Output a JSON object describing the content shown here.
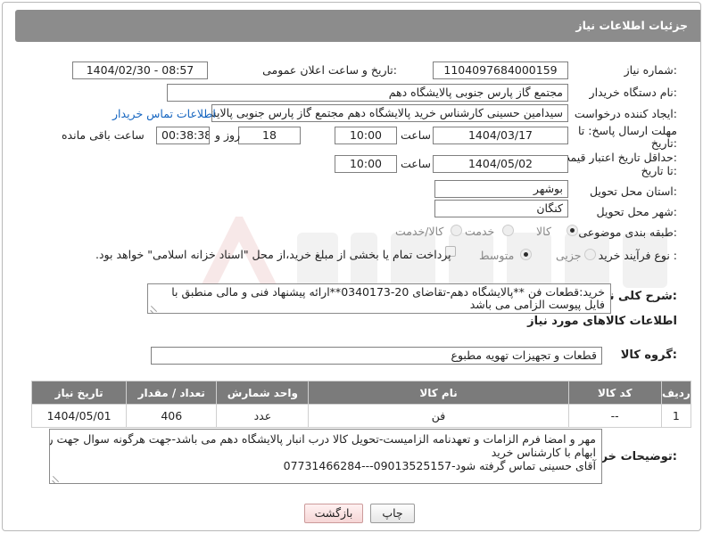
{
  "header": {
    "title": "جزئیات اطلاعات نیاز"
  },
  "form": {
    "need_number_label": "شماره نیاز:",
    "need_number": "1104097684000159",
    "announce_label": "تاریخ و ساعت اعلان عمومی:",
    "announce_value": "1404/02/30 - 08:57",
    "buyer_org_label": "نام دستگاه خریدار:",
    "buyer_org": "مجتمع گاز پارس جنوبی  پالایشگاه دهم",
    "creator_label": "ایجاد کننده درخواست:",
    "creator": "سیدامین حسینی کارشناس خرید پالایشگاه دهم  مجتمع گاز پارس جنوبی  پالایشگاه دهم",
    "contact_link": "اطلاعات تماس خریدار",
    "deadline_label_1": "مهلت ارسال پاسخ: تا",
    "deadline_label_2": "تاریخ:",
    "deadline_date": "1404/03/17",
    "time_label": "ساعت",
    "deadline_time": "10:00",
    "days_value": "18",
    "days_label": "روز و",
    "remaining_time": "00:38:38",
    "remaining_label": "ساعت باقی مانده",
    "validity_label_1": "حداقل تاریخ اعتبار قیمت:",
    "validity_label_2": "تا تاریخ:",
    "validity_date": "1404/05/02",
    "validity_time": "10:00",
    "province_label": "استان محل تحویل:",
    "province": "بوشهر",
    "city_label": "شهر محل تحویل:",
    "city": "کنگان",
    "category_label": "طبقه بندی موضوعی:",
    "category_options": [
      "کالا",
      "خدمت",
      "کالا/خدمت"
    ],
    "category_selected": "کالا",
    "process_label": "نوع فرآیند خرید :",
    "process_options": [
      "جزیی",
      "متوسط"
    ],
    "process_selected": "متوسط",
    "payment_note": "پرداخت تمام یا بخشی از مبلغ خرید،از محل \"اسناد خزانه اسلامی\" خواهد بود.",
    "description_label": "شرح کلی نیاز:",
    "description": "خرید:قطعات فن **پالایشگاه دهم-تقاضای 20-0340173**ارائه پیشنهاد فنی و مالی منطبق با فایل پیوست الزامی می باشد"
  },
  "goods": {
    "section_title": "اطلاعات کالاهای مورد نیاز",
    "group_label": "گروه کالا:",
    "group_value": "قطعات و تجهیزات تهویه مطبوع",
    "columns": [
      "ردیف",
      "کد کالا",
      "نام کالا",
      "واحد شمارش",
      "تعداد / مقدار",
      "تاریخ نیاز"
    ],
    "rows": [
      {
        "row": "1",
        "code": "--",
        "name": "فن",
        "unit": "عدد",
        "qty": "406",
        "date": "1404/05/01"
      }
    ]
  },
  "buyer_notes": {
    "label": "توضیحات خریدار:",
    "line1": "مهر و امضا فرم الزامات و تعهدنامه الزامیست-تحویل کالا درب انبار پالایشگاه دهم می باشد-جهت هرگونه سوال جهت رفع",
    "line2": "ابهام با کارشناس خرید",
    "line3": "آقای حسینی تماس گرفته شود-09013525157---07731466284"
  },
  "buttons": {
    "print": "چاپ",
    "back": "بازگشت"
  },
  "colors": {
    "header_bg": "#8c8c8c",
    "table_header_bg": "#7b7b7b",
    "link": "#1565c0",
    "back_button": "#f6d6d6"
  }
}
